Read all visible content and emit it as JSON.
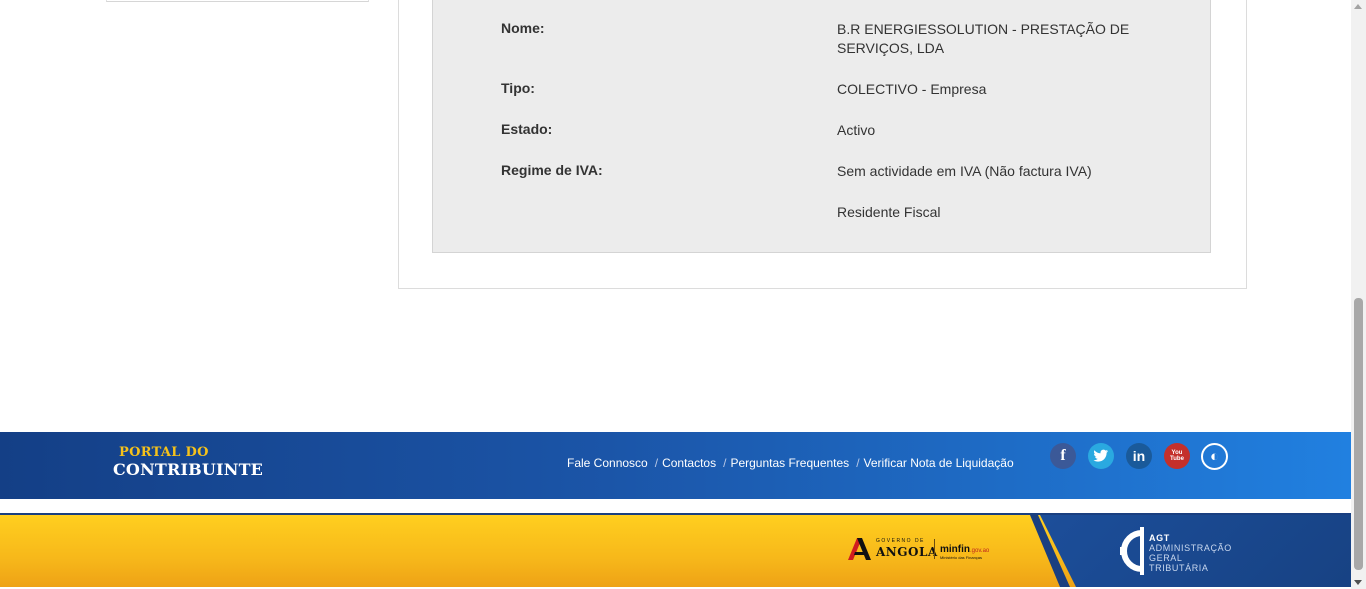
{
  "details": {
    "nome": {
      "label": "Nome:",
      "value": "B.R ENERGIESSOLUTION - PRESTAÇÃO DE SERVIÇOS, LDA"
    },
    "tipo": {
      "label": "Tipo:",
      "value": "COLECTIVO - Empresa"
    },
    "estado": {
      "label": "Estado:",
      "value": "Activo"
    },
    "regime_iva": {
      "label": "Regime de IVA:",
      "value": "Sem actividade em IVA (Não factura IVA)"
    },
    "residencia": {
      "value": "Residente Fiscal"
    }
  },
  "footer": {
    "logo_top": "PORTAL DO",
    "logo_bottom": "CONTRIBUINTE",
    "links": [
      "Fale Connosco",
      "Contactos",
      "Perguntas Frequentes",
      "Verificar Nota de Liquidação"
    ],
    "separator": "/",
    "social": [
      {
        "name": "facebook-icon",
        "glyph": "f",
        "color": "#3b5998"
      },
      {
        "name": "twitter-icon",
        "glyph": "🐦",
        "color": "#2aa9e0"
      },
      {
        "name": "linkedin-icon",
        "glyph": "in",
        "color": "#1a5a9a"
      },
      {
        "name": "youtube-icon",
        "glyph": "You Tube",
        "color": "#c4302b"
      },
      {
        "name": "portal-icon",
        "glyph": "◐",
        "color": "#ffffff"
      }
    ],
    "gov_logo_top": "GOVERNO DE",
    "gov_logo_main": "ANGOLA",
    "minfin_main": "minfin",
    "minfin_domain": ".gov.ao",
    "minfin_sub": "Ministério das Finanças",
    "agt_abbr": "AGT",
    "agt_lines": [
      "ADMINISTRAÇÃO",
      "GERAL",
      "TRIBUTÁRIA"
    ]
  }
}
